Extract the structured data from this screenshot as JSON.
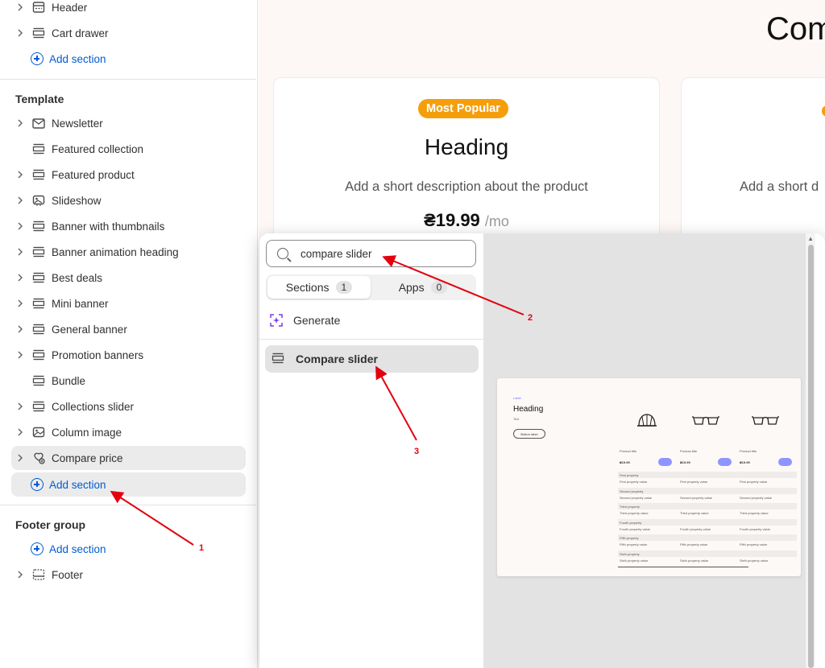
{
  "sidebar": {
    "header_items": [
      {
        "label": "Header",
        "icon": "header-icon"
      },
      {
        "label": "Cart drawer",
        "icon": "section-icon"
      }
    ],
    "add_section_label": "Add section",
    "template_title": "Template",
    "template_items": [
      {
        "label": "Newsletter",
        "icon": "envelope-icon",
        "chevron": true
      },
      {
        "label": "Featured collection",
        "icon": "section-icon",
        "chevron": false
      },
      {
        "label": "Featured product",
        "icon": "section-icon",
        "chevron": true
      },
      {
        "label": "Slideshow",
        "icon": "slideshow-icon",
        "chevron": true
      },
      {
        "label": "Banner with thumbnails",
        "icon": "section-icon",
        "chevron": true
      },
      {
        "label": "Banner animation heading",
        "icon": "section-icon",
        "chevron": true
      },
      {
        "label": "Best deals",
        "icon": "section-icon",
        "chevron": true
      },
      {
        "label": "Mini banner",
        "icon": "section-icon",
        "chevron": true
      },
      {
        "label": "General banner",
        "icon": "section-icon",
        "chevron": true
      },
      {
        "label": "Promotion banners",
        "icon": "section-icon",
        "chevron": true
      },
      {
        "label": "Bundle",
        "icon": "section-icon",
        "chevron": false
      },
      {
        "label": "Collections slider",
        "icon": "section-icon",
        "chevron": true
      },
      {
        "label": "Column image",
        "icon": "image-icon",
        "chevron": true
      },
      {
        "label": "Compare price",
        "icon": "app-block-icon",
        "chevron": true
      }
    ],
    "footer_title": "Footer group",
    "footer_items": [
      {
        "label": "Footer",
        "icon": "footer-icon"
      }
    ]
  },
  "preview": {
    "title": "Com",
    "card1": {
      "badge": "Most Popular",
      "heading": "Heading",
      "description": "Add a short description about the product",
      "price": "₴19.99",
      "period": "/mo"
    },
    "card2": {
      "description": "Add a short d"
    }
  },
  "picker": {
    "search_value": "compare slider",
    "tabs": [
      {
        "label": "Sections",
        "count": "1"
      },
      {
        "label": "Apps",
        "count": "0"
      }
    ],
    "generate_label": "Generate",
    "result_label": "Compare slider",
    "thumbnail": {
      "label": "Label",
      "heading": "Heading",
      "text": "Text",
      "button": "Button label",
      "product_title": "Product title",
      "price": "₴19.99",
      "properties": [
        {
          "name": "First property",
          "value": "First property value"
        },
        {
          "name": "Second property",
          "value": "Second property value"
        },
        {
          "name": "Third property",
          "value": "Third property value"
        },
        {
          "name": "Fourth property",
          "value": "Fourth property value"
        },
        {
          "name": "Fifth property",
          "value": "Fifth property value"
        },
        {
          "name": "Sixth property",
          "value": "Sixth property value"
        }
      ]
    }
  },
  "annotations": {
    "one": "1",
    "two": "2",
    "three": "3"
  },
  "colors": {
    "badge": "#f59e0b",
    "link": "#005bd3",
    "arrow": "#e3000f",
    "cart": "#8e95ff"
  }
}
